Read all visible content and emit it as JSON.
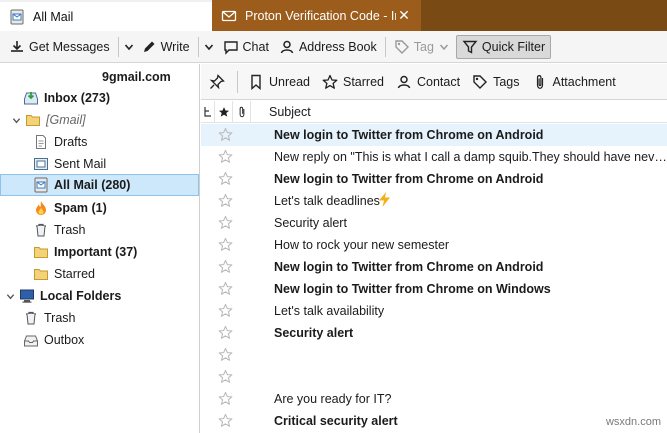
{
  "tabs": [
    {
      "label": "All Mail",
      "icon": "mail-folder-icon",
      "active": true
    },
    {
      "label": "Proton Verification Code - In",
      "icon": "envelope-icon",
      "active": false,
      "close": "✕"
    }
  ],
  "toolbar": {
    "get_messages": "Get Messages",
    "write": "Write",
    "chat": "Chat",
    "address_book": "Address Book",
    "tag": "Tag",
    "quick_filter": "Quick Filter"
  },
  "folders": {
    "account": "9gmail.com",
    "items": [
      {
        "label": "Inbox (273)",
        "bold": true
      },
      {
        "label": "[Gmail]",
        "italic": true
      },
      {
        "label": "Drafts"
      },
      {
        "label": "Sent Mail"
      },
      {
        "label": "All Mail (280)",
        "bold": true,
        "selected": true
      },
      {
        "label": "Spam (1)",
        "bold": true
      },
      {
        "label": "Trash"
      },
      {
        "label": "Important (37)",
        "bold": true
      },
      {
        "label": "Starred"
      },
      {
        "label": "Local Folders",
        "bold": true
      },
      {
        "label": "Trash"
      },
      {
        "label": "Outbox"
      }
    ]
  },
  "quick_filter_bar": {
    "unread": "Unread",
    "starred": "Starred",
    "contact": "Contact",
    "tags": "Tags",
    "attachment": "Attachment"
  },
  "columns": {
    "subject": "Subject"
  },
  "threads": [
    {
      "subject": "New login to Twitter from Chrome on Android",
      "unread": true,
      "selected": true
    },
    {
      "subject": "New reply on \"This is what I call a damp squib.They should have never att...",
      "unread": false
    },
    {
      "subject": "New login to Twitter from Chrome on Android",
      "unread": true
    },
    {
      "subject": "Let's talk deadlines",
      "unread": false,
      "bolt": true
    },
    {
      "subject": "Security alert",
      "unread": false
    },
    {
      "subject": "How to rock your new semester",
      "unread": false
    },
    {
      "subject": "New login to Twitter from Chrome on Android",
      "unread": true
    },
    {
      "subject": "New login to Twitter from Chrome on Windows",
      "unread": true
    },
    {
      "subject": "Let's talk availability",
      "unread": false
    },
    {
      "subject": "Security alert",
      "unread": true
    },
    {
      "subject": "",
      "unread": false
    },
    {
      "subject": "",
      "unread": false
    },
    {
      "subject": "Are you ready for IT?",
      "unread": false
    },
    {
      "subject": "Critical security alert",
      "unread": true
    }
  ],
  "watermark": "wsxdn.com"
}
